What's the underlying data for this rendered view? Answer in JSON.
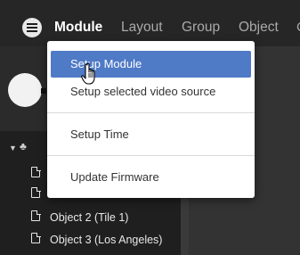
{
  "menubar": {
    "items": [
      {
        "label": "Module"
      },
      {
        "label": "Layout"
      },
      {
        "label": "Group"
      },
      {
        "label": "Object"
      }
    ],
    "overflow_label": "C",
    "hamburger_icon": "hamburger-menu-icon"
  },
  "dropdown": {
    "items": [
      {
        "label": "Setup Module"
      },
      {
        "label": "Setup selected video source"
      },
      {
        "label": "Setup Time"
      },
      {
        "label": "Update Firmware"
      }
    ]
  },
  "tree": {
    "node_icon": "sitemap-icon",
    "items": [
      {
        "label": "Object 2 (Tile 1)"
      },
      {
        "label": "Object 3 (Los Angeles)"
      }
    ]
  },
  "colors": {
    "menubar_bg": "#262626",
    "menu_active": "#ffffff",
    "menu_inactive": "#a9a9a9",
    "highlight": "#4f7ac6",
    "dropdown_bg": "#ffffff"
  }
}
